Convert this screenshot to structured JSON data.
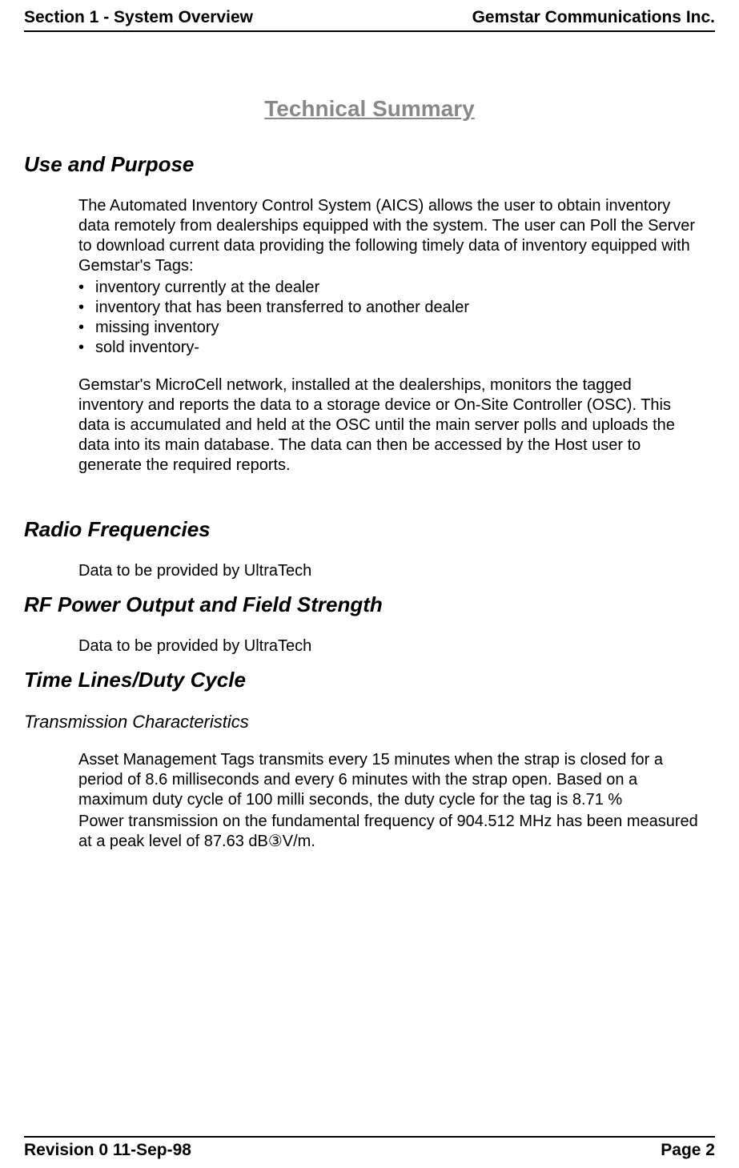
{
  "header": {
    "left": "Section 1 - System Overview",
    "right": "Gemstar Communications Inc."
  },
  "title": "Technical Summary",
  "sections": {
    "useAndPurpose": {
      "heading": "Use and Purpose",
      "intro": "The Automated Inventory Control System (AICS) allows the user to obtain inventory data remotely from dealerships equipped with the system.  The user can Poll the Server to download current data providing the following timely data of inventory equipped with Gemstar's Tags:",
      "bullets": [
        "inventory currently at the dealer",
        "inventory that has been transferred to another dealer",
        "missing inventory",
        "sold inventory-"
      ],
      "para2": "Gemstar's MicroCell network, installed at the dealerships, monitors the tagged inventory and reports the data to a storage device or On-Site Controller (OSC).  This data is accumulated and held at the OSC until the main server polls and uploads the data into its main database.  The data can then be accessed by the Host user to generate the required reports."
    },
    "radioFrequencies": {
      "heading": "Radio Frequencies",
      "body": "Data to be provided by UltraTech"
    },
    "rfPower": {
      "heading": "RF Power Output and Field Strength",
      "body": "Data to be provided by UltraTech"
    },
    "timeLines": {
      "heading": "Time Lines/Duty Cycle",
      "subheading": "Transmission Characteristics",
      "para1": "Asset Management Tags transmits every 15 minutes when the strap is closed for a period of 8.6 milliseconds and every 6 minutes with the strap open.  Based on a maximum duty cycle of 100 milli seconds, the duty cycle for the tag is 8.71 %",
      "para2": "Power transmission on the fundamental frequency of 904.512 MHz has been measured at a peak level of 87.63 dB③V/m."
    }
  },
  "footer": {
    "left": "Revision 0  11-Sep-98",
    "right": "Page 2"
  }
}
